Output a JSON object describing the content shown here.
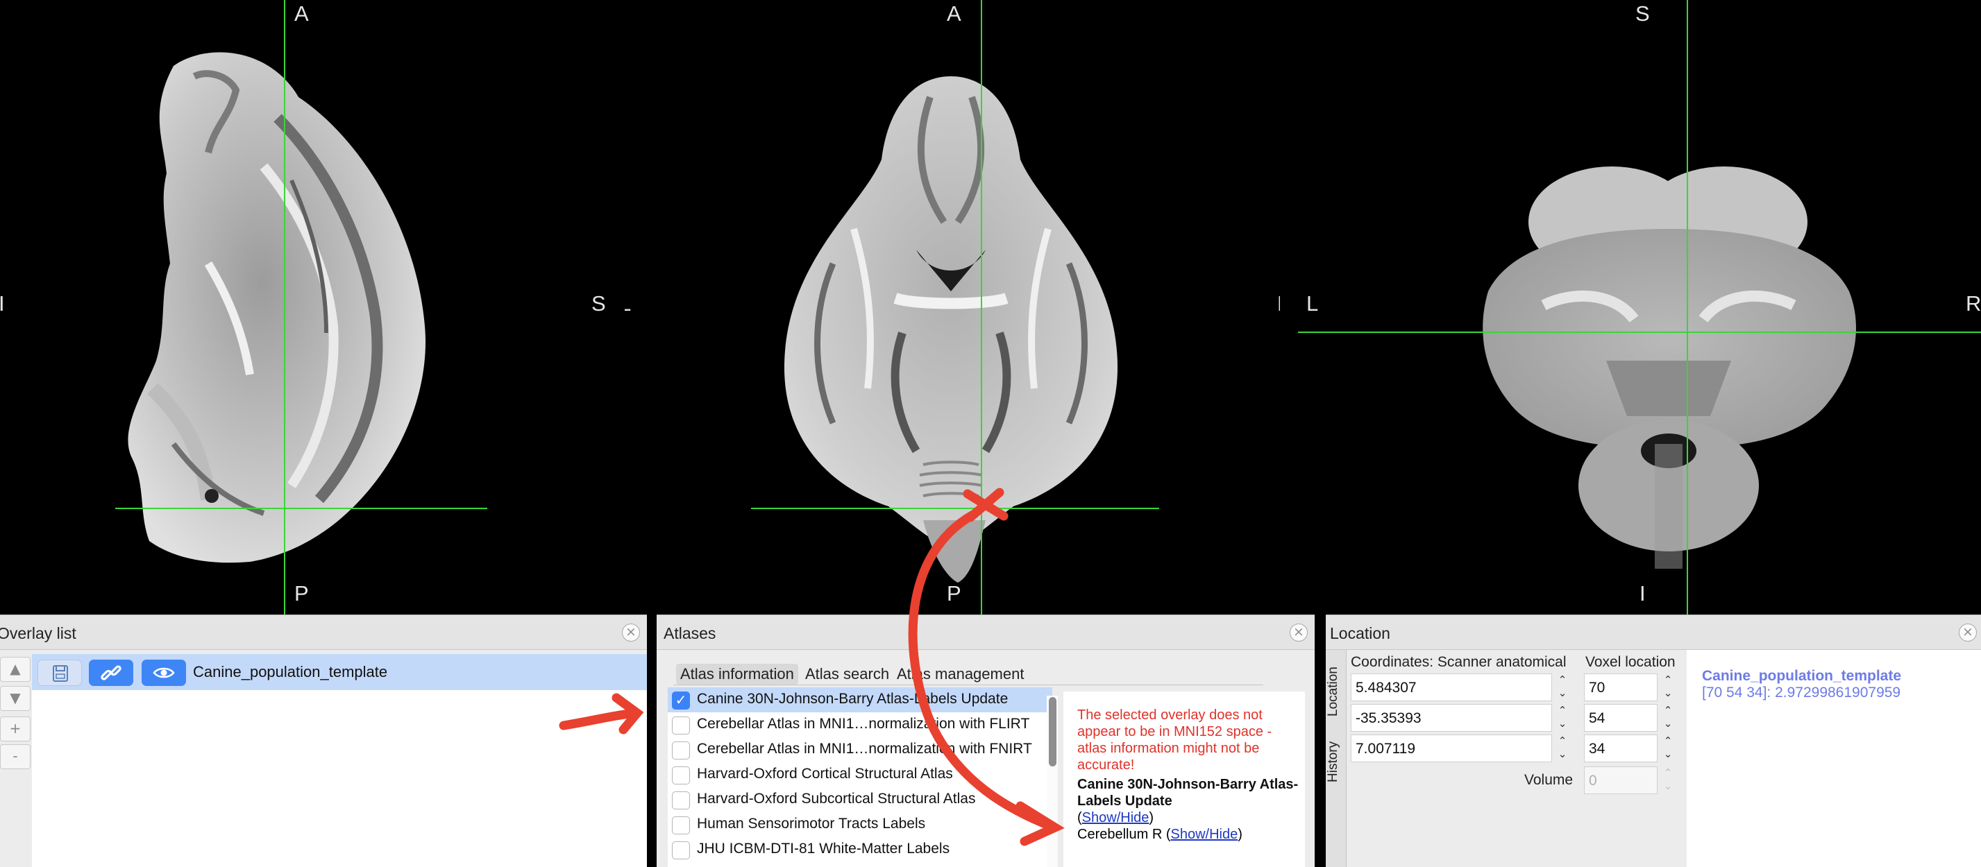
{
  "views": {
    "sagittal": {
      "top": "A",
      "bottom": "P",
      "left": "I",
      "right": "S"
    },
    "axial": {
      "top": "A",
      "bottom": "P",
      "left": "L",
      "right": "R"
    },
    "coronal": {
      "top": "S",
      "bottom": "I",
      "left": "L",
      "right": "R"
    }
  },
  "overlay_panel": {
    "title": "Overlay list",
    "side_buttons": [
      "▲",
      "▼",
      "+",
      "-"
    ],
    "items": [
      {
        "name": "Canine_population_template",
        "selected": true
      }
    ]
  },
  "atlas_panel": {
    "title": "Atlases",
    "tabs": [
      "Atlas information",
      "Atlas search",
      "Atlas management"
    ],
    "active_tab": "Atlas information",
    "atlases": [
      {
        "label": "Canine 30N-Johnson-Barry Atlas-Labels Update",
        "checked": true
      },
      {
        "label": "Cerebellar Atlas in MNI1…normalization with FLIRT",
        "checked": false
      },
      {
        "label": "Cerebellar Atlas in MNI1…normalization with FNIRT",
        "checked": false
      },
      {
        "label": "Harvard-Oxford Cortical Structural Atlas",
        "checked": false
      },
      {
        "label": "Harvard-Oxford Subcortical Structural Atlas",
        "checked": false
      },
      {
        "label": "Human Sensorimotor Tracts Labels",
        "checked": false
      },
      {
        "label": "JHU ICBM-DTI-81 White-Matter Labels",
        "checked": false
      }
    ],
    "info": {
      "warning": "The selected overlay does not appear to be in MNI152 space - atlas information might not be accurate!",
      "atlas_name": "Canine 30N-Johnson-Barry Atlas-Labels Update",
      "show_hide": "Show/Hide",
      "region": "Cerebellum R",
      "open_paren": "(",
      "close_paren": ")"
    }
  },
  "location_panel": {
    "title": "Location",
    "vertical_tabs": [
      "Location",
      "History"
    ],
    "coords_header": "Coordinates: Scanner anatomical",
    "voxel_header": "Voxel location",
    "coordinates": [
      "5.484307",
      "-35.35393",
      "7.007119"
    ],
    "voxels": [
      "70",
      "54",
      "34"
    ],
    "volume_label": "Volume",
    "volume_value": "0",
    "info_name": "Canine_population_template",
    "info_value": "[70 54 34]: 2.97299861907959"
  },
  "colors": {
    "crosshair": "#39d639",
    "annotation": "#e8412f",
    "selection": "#c3d9fa",
    "warning": "#e0322a",
    "info_text": "#6d7be6"
  },
  "icons": [
    "save-icon",
    "link-icon",
    "eye-icon",
    "close-icon",
    "checkbox-check-icon",
    "spin-arrows-icon"
  ]
}
